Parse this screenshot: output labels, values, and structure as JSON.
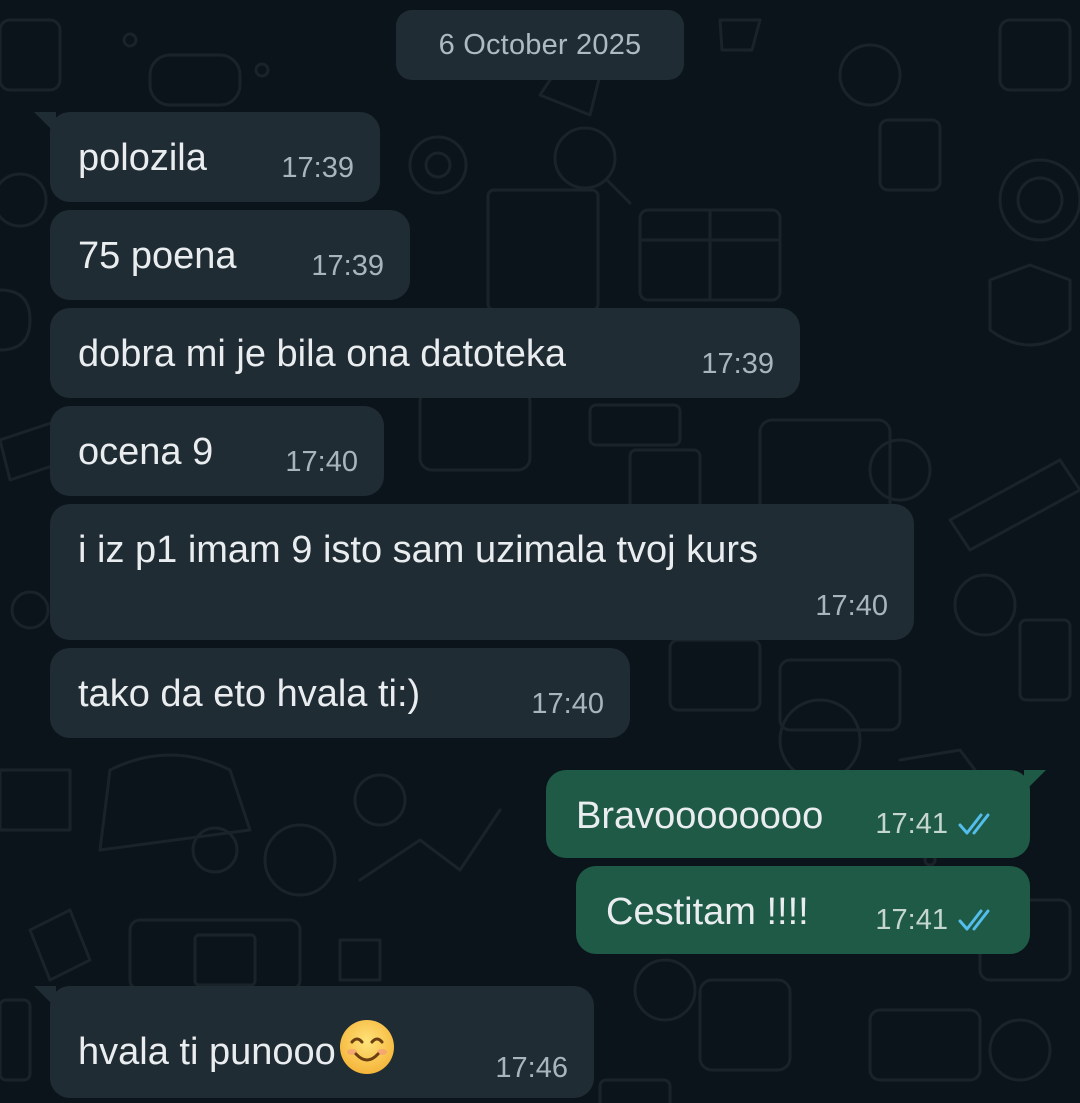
{
  "colors": {
    "background": "#0b141a",
    "incoming_bubble": "#202c33",
    "outgoing_bubble": "#1f5a46",
    "text": "#e9edef",
    "meta": "#a9b5bc",
    "read_tick": "#53bdeb"
  },
  "date_divider": "6 October 2025",
  "messages": [
    {
      "direction": "in",
      "text": "polozila",
      "time": "17:39"
    },
    {
      "direction": "in",
      "text": "75 poena",
      "time": "17:39"
    },
    {
      "direction": "in",
      "text": "dobra mi je bila ona datoteka",
      "time": "17:39"
    },
    {
      "direction": "in",
      "text": "ocena 9",
      "time": "17:40"
    },
    {
      "direction": "in",
      "text": "i iz p1 imam 9 isto sam uzimala tvoj kurs",
      "time": "17:40"
    },
    {
      "direction": "in",
      "text": "tako da eto hvala ti:)",
      "time": "17:40"
    },
    {
      "direction": "out",
      "text": "Bravoooooooo",
      "time": "17:41",
      "status_icon": "double-check-read-icon"
    },
    {
      "direction": "out",
      "text": "Cestitam !!!!",
      "time": "17:41",
      "status_icon": "double-check-read-icon"
    },
    {
      "direction": "in",
      "text": "hvala ti punooo",
      "time": "17:46",
      "emoji": "smiling-face-emoji"
    }
  ]
}
